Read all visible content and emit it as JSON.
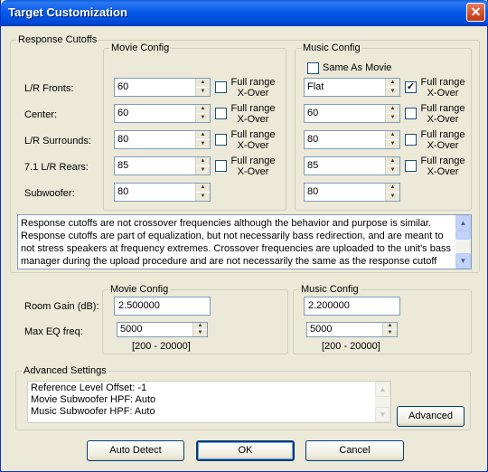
{
  "window": {
    "title": "Target Customization",
    "close_glyph": "✕"
  },
  "response": {
    "legend": "Response Cutoffs",
    "movie_legend": "Movie Config",
    "music_legend": "Music Config",
    "same_as_movie": "Same As Movie",
    "full_range": "Full range",
    "xover": "X-Over",
    "rows": [
      {
        "label": "L/R Fronts:",
        "movie": "60",
        "music": "Flat",
        "movie_full": false,
        "music_full": true
      },
      {
        "label": "Center:",
        "movie": "60",
        "music": "60",
        "movie_full": false,
        "music_full": false
      },
      {
        "label": "L/R Surrounds:",
        "movie": "80",
        "music": "80",
        "movie_full": false,
        "music_full": false
      },
      {
        "label": "7.1 L/R Rears:",
        "movie": "85",
        "music": "85",
        "movie_full": false,
        "music_full": false
      },
      {
        "label": "Subwoofer:",
        "movie": "80",
        "music": "80"
      }
    ],
    "note": "Response cutoffs are not crossover frequencies although the behavior and purpose is similar. Response cutoffs are part of equalization, but not necessarily bass redirection, and are meant to not stress speakers at frequency extremes.  Crossover frequencies are uploaded to the unit's bass manager during the upload procedure and are not necessarily the same as the response cutoff"
  },
  "gain": {
    "room_gain_label": "Room Gain (dB):",
    "max_eq_label": "Max EQ freq:",
    "movie_legend": "Movie Config",
    "music_legend": "Music Config",
    "movie_room_gain": "2.500000",
    "music_room_gain": "2.200000",
    "movie_max_eq": "5000",
    "music_max_eq": "5000",
    "range_hint": "[200 - 20000]"
  },
  "advanced": {
    "legend": "Advanced Settings",
    "lines": [
      "Reference Level Offset: -1",
      "Movie Subwoofer HPF: Auto",
      "Music Subwoofer HPF: Auto"
    ],
    "button": "Advanced"
  },
  "footer": {
    "auto_detect": "Auto Detect",
    "ok": "OK",
    "cancel": "Cancel"
  },
  "check_mark": "✓",
  "arrow_up": "▲",
  "arrow_down": "▼"
}
